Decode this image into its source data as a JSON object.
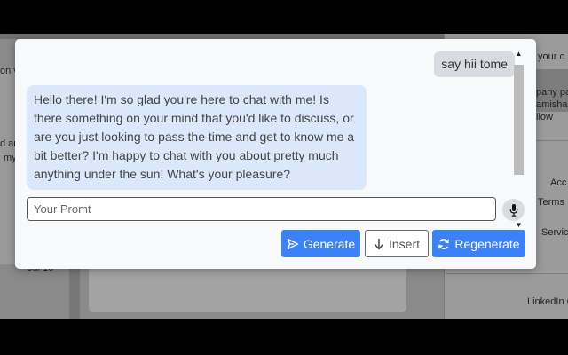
{
  "background": {
    "fragments": {
      "left_1": "on v",
      "left_2": "d ar",
      "left_3": "my",
      "left_date": "Jul 10",
      "right_1": "your c",
      "right_2": "pany pa",
      "right_3": "amisha &",
      "right_4": "llow",
      "right_5": "Acc",
      "right_6": "Terms",
      "right_7": "Servic",
      "right_footer": "LinkedIn C"
    }
  },
  "chat": {
    "messages": [
      {
        "role": "user",
        "text": "say hii tome"
      },
      {
        "role": "assistant",
        "text": "Hello there! I'm so glad you're here to chat with me! Is there something on your mind that you'd like to discuss, or are you just looking to pass the time and get to know me a bit better? I'm happy to chat with you about pretty much anything under the sun! What's your pleasure?"
      }
    ]
  },
  "prompt": {
    "placeholder": "Your Promt",
    "value": ""
  },
  "buttons": {
    "generate": "Generate",
    "insert": "Insert",
    "regenerate": "Regenerate"
  },
  "icons": {
    "scroll_up": "scroll-up-arrow-icon",
    "scroll_down": "scroll-down-arrow-icon",
    "mic": "microphone-icon",
    "generate": "send-icon",
    "insert": "arrow-down-icon",
    "regenerate": "sync-icon"
  },
  "colors": {
    "primary": "#3b82f6",
    "bot_bubble": "#dbe7fb",
    "user_bubble": "#d8dbe0",
    "modal_bg": "#f8f9fb"
  }
}
